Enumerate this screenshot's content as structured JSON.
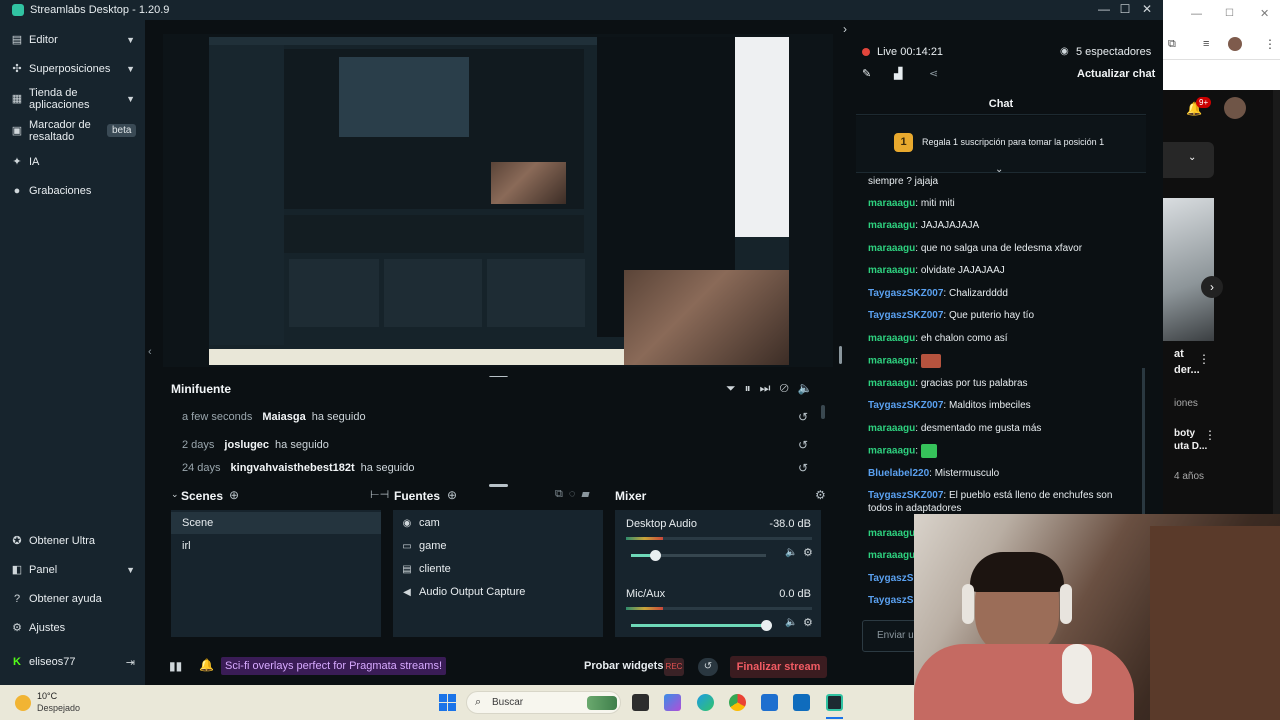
{
  "window": {
    "title": "Streamlabs Desktop - 1.20.9"
  },
  "sidebar": {
    "items": [
      {
        "label": "Editor",
        "icon": "editor-icon",
        "expandable": true
      },
      {
        "label": "Superposiciones",
        "icon": "overlays-icon",
        "expandable": true
      },
      {
        "label": "Tienda de aplicaciones",
        "icon": "app-store-icon",
        "expandable": true
      },
      {
        "label": "Marcador de resaltado",
        "icon": "highlighter-icon",
        "badge": "beta"
      },
      {
        "label": "IA",
        "icon": "ai-icon"
      },
      {
        "label": "Grabaciones",
        "icon": "recordings-icon"
      }
    ],
    "bottom_items": [
      {
        "label": "Obtener Ultra",
        "icon": "ultra-icon"
      },
      {
        "label": "Panel",
        "icon": "panel-icon",
        "expandable": true
      },
      {
        "label": "Obtener ayuda",
        "icon": "help-icon"
      },
      {
        "label": "Ajustes",
        "icon": "settings-icon"
      }
    ],
    "user": {
      "name": "eliseos77",
      "icon": "kick-icon"
    }
  },
  "minifuente": {
    "title": "Minifuente",
    "events": [
      {
        "time": "a few seconds",
        "user": "Maiasga",
        "action": "ha seguido"
      },
      {
        "time": "2 days",
        "user": "joslugec",
        "action": "ha seguido"
      },
      {
        "time": "24 days",
        "user": "kingvahvaisthebest182t",
        "action": "ha seguido"
      }
    ]
  },
  "scenes": {
    "title": "Scenes",
    "items": [
      "Scene",
      "irl"
    ],
    "selected": "Scene"
  },
  "sources": {
    "title": "Fuentes",
    "items": [
      {
        "label": "cam",
        "icon": "camera-icon"
      },
      {
        "label": "game",
        "icon": "display-icon"
      },
      {
        "label": "cliente",
        "icon": "window-icon"
      },
      {
        "label": "Audio Output Capture",
        "icon": "speaker-icon"
      }
    ]
  },
  "mixer": {
    "title": "Mixer",
    "channels": [
      {
        "label": "Desktop Audio",
        "db": "-38.0 dB",
        "level": 0.2,
        "volume": 0.18
      },
      {
        "label": "Mic/Aux",
        "db": "0.0 dB",
        "level": 0.2,
        "volume": 1.0
      }
    ]
  },
  "footer": {
    "promo": "Sci-fi overlays perfect for Pragmata streams!",
    "test_widgets": "Probar widgets",
    "rec": "REC",
    "end_stream": "Finalizar stream"
  },
  "live": {
    "status": "Live 00:14:21",
    "viewers": "5 espectadores",
    "refresh_chat": "Actualizar chat",
    "chat_title": "Chat",
    "pinned": "Regala 1 suscripción para tomar la posición 1",
    "pinned_rank": "1",
    "input_placeholder": "Enviar un mensaje",
    "messages": [
      {
        "user": "",
        "text": "siempre ? jajaja"
      },
      {
        "user": "maraaagu",
        "text": "miti miti"
      },
      {
        "user": "maraaagu",
        "text": "JAJAJAJAJA"
      },
      {
        "user": "maraaagu",
        "text": "que no salga una de ledesma xfavor"
      },
      {
        "user": "maraaagu",
        "text": "olvidate JAJAJAAJ"
      },
      {
        "user": "TaygaszSKZ007",
        "text": "Chalizardddd"
      },
      {
        "user": "TaygaszSKZ007",
        "text": "Que puterio hay tío"
      },
      {
        "user": "maraaagu",
        "text": "eh chalon como así"
      },
      {
        "user": "maraaagu",
        "text": ""
      },
      {
        "user": "maraaagu",
        "text": "gracias por tus palabras"
      },
      {
        "user": "TaygaszSKZ007",
        "text": "Malditos imbeciles"
      },
      {
        "user": "maraaagu",
        "text": "desmentado me gusta más"
      },
      {
        "user": "maraaagu",
        "text": ""
      },
      {
        "user": "Bluelabel220",
        "text": "Mistermusculo"
      },
      {
        "user": "TaygaszSKZ007",
        "text": "El pueblo está lleno de enchufes son todos in adaptadores"
      },
      {
        "user": "maraaagu",
        "text": ""
      },
      {
        "user": "maraaagu",
        "text": ""
      },
      {
        "user": "TaygaszSk",
        "text": ""
      },
      {
        "user": "TaygaszSk",
        "text": ""
      }
    ]
  },
  "browser": {
    "notification_count": "9+",
    "snippet_1": "at",
    "snippet_2": "der...",
    "snippet_3": "iones",
    "snippet_4": "boty",
    "snippet_5": "uta D...",
    "snippet_6": "4 años"
  },
  "taskbar": {
    "temperature": "10°C",
    "weather": "Despejado",
    "search_placeholder": "Buscar"
  }
}
